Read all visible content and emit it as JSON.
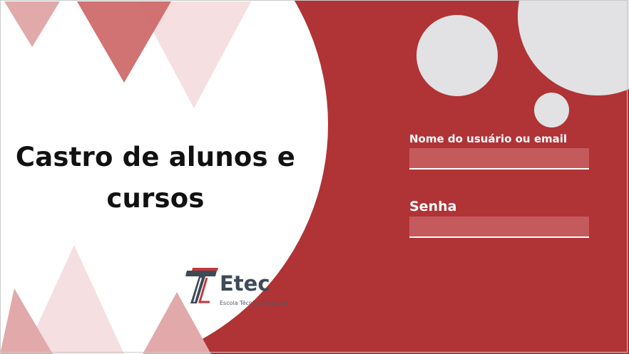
{
  "title": "Castro de alunos e cursos",
  "form": {
    "username_label": "Nome do usuário ou email",
    "username_value": "",
    "password_label": "Senha",
    "password_value": ""
  },
  "logo": {
    "name": "Etec",
    "subtitle": "Escola Técnica Estadual"
  },
  "colors": {
    "background": "#b03336",
    "field": "#c45a5c",
    "bubble": "#e2e2e4",
    "triangle_dark": "#cf6a6c",
    "triangle_light": "#f3dcdd"
  }
}
